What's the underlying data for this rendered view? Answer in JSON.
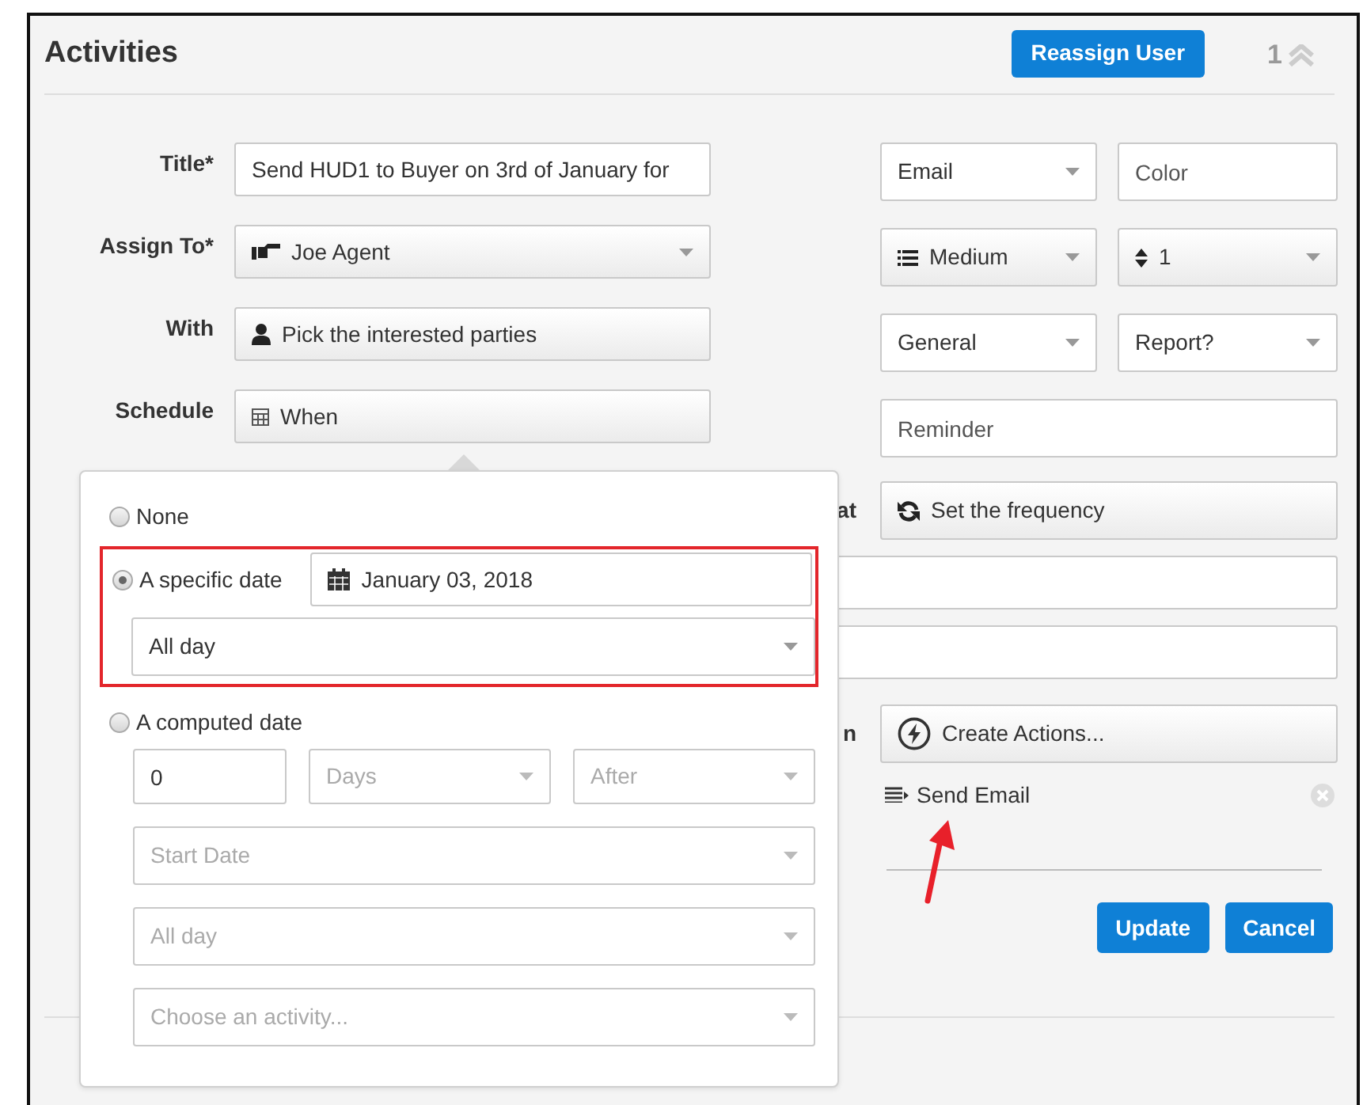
{
  "header": {
    "title": "Activities",
    "reassign_button": "Reassign User",
    "count": "1"
  },
  "left_fields": [
    {
      "label": "Title*",
      "kind": "input",
      "value": "Send HUD1 to Buyer on 3rd of January for"
    },
    {
      "label": "Assign To*",
      "kind": "user-select",
      "value": "Joe Agent"
    },
    {
      "label": "With",
      "kind": "party-picker",
      "value": "Pick the interested parties"
    },
    {
      "label": "Schedule",
      "kind": "schedule-button",
      "value": "When"
    }
  ],
  "right_fields": [
    [
      {
        "kind": "select",
        "value": "Email"
      },
      {
        "kind": "input",
        "placeholder": "Color"
      }
    ],
    [
      {
        "kind": "priority-select",
        "value": "Medium"
      },
      {
        "kind": "stepper-select",
        "value": "1"
      }
    ],
    [
      {
        "kind": "select",
        "value": "General"
      },
      {
        "kind": "select",
        "value": "Report?"
      }
    ],
    [
      {
        "kind": "input",
        "placeholder": "Reminder"
      }
    ]
  ],
  "lower_rows": [
    {
      "label": "at",
      "kind": "frequency-button",
      "value": "Set the frequency"
    },
    {
      "kind": "input"
    },
    {
      "kind": "input"
    },
    {
      "label": "n",
      "kind": "actions-button",
      "value": "Create Actions..."
    }
  ],
  "actions": [
    {
      "label": "Send Email"
    }
  ],
  "buttons": [
    "Update",
    "Cancel"
  ],
  "popover": {
    "options": [
      {
        "label": "None",
        "selected": false,
        "highlighted": false
      },
      {
        "label": "A specific date",
        "selected": true,
        "highlighted": true,
        "inline_field": {
          "kind": "date",
          "value": "January 03, 2018",
          "disabled": false
        },
        "rows": [
          [
            {
              "kind": "select",
              "value": "All day",
              "disabled": false
            }
          ]
        ]
      },
      {
        "label": "A computed date",
        "selected": false,
        "highlighted": false,
        "rows": [
          [
            {
              "kind": "number",
              "value": "0",
              "disabled": false
            },
            {
              "kind": "select",
              "value": "Days",
              "disabled": true
            },
            {
              "kind": "select",
              "value": "After",
              "disabled": true
            }
          ],
          [
            {
              "kind": "select",
              "value": "Start Date",
              "disabled": true
            }
          ],
          [
            {
              "kind": "select",
              "value": "All day",
              "disabled": true
            }
          ],
          [
            {
              "kind": "select",
              "value": "Choose an activity...",
              "disabled": true
            }
          ]
        ]
      }
    ]
  }
}
